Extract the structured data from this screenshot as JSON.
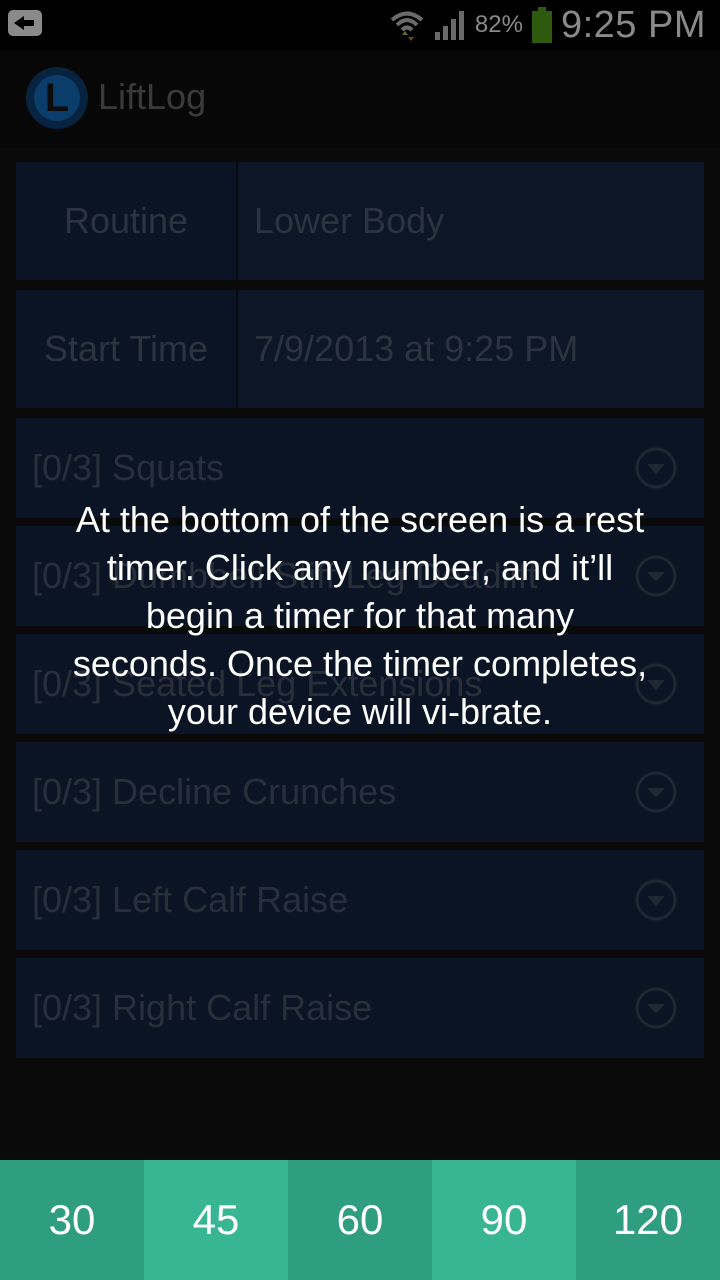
{
  "status_bar": {
    "battery_percent": "82%",
    "time": "9:25 PM",
    "icons": [
      "back-notification-icon",
      "wifi-icon",
      "signal-icon",
      "battery-icon"
    ]
  },
  "app": {
    "logo_letter": "L",
    "title": "LiftLog"
  },
  "workout": {
    "routine_label": "Routine",
    "routine_value": "Lower Body",
    "start_label": "Start Time",
    "start_value": "7/9/2013 at 9:25 PM"
  },
  "exercises": [
    {
      "label": "[0/3] Squats"
    },
    {
      "label": "[0/3] Dumbbell Stiff Leg Deadlift"
    },
    {
      "label": "[0/3] Seated Leg Extensions"
    },
    {
      "label": "[0/3] Decline Crunches"
    },
    {
      "label": "[0/3] Left Calf Raise"
    },
    {
      "label": "[0/3] Right Calf Raise"
    }
  ],
  "tutorial": {
    "text": "At the bottom of the screen is a rest timer. Click any number, and it’ll begin a timer for that many seconds. Once the timer completes, your device will vi-brate."
  },
  "rest_timer": {
    "buttons": [
      "30",
      "45",
      "60",
      "90",
      "120"
    ]
  },
  "colors": {
    "timer_dark": "#2f9e80",
    "timer_light": "#38b694",
    "logo_blue": "#0b3d6a"
  }
}
